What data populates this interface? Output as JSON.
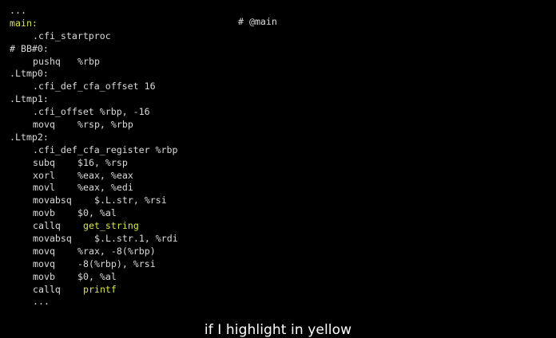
{
  "code": {
    "lines": [
      {
        "kind": "plain",
        "indent": false,
        "text": "..."
      },
      {
        "kind": "label",
        "indent": false,
        "text": "main:"
      },
      {
        "kind": "plain",
        "indent": true,
        "text": ".cfi_startproc"
      },
      {
        "kind": "plain",
        "indent": false,
        "text": "# BB#0:"
      },
      {
        "kind": "instr",
        "indent": true,
        "op": "pushq",
        "args": "%rbp",
        "opw": 8
      },
      {
        "kind": "plain",
        "indent": false,
        "text": ".Ltmp0:"
      },
      {
        "kind": "plain",
        "indent": true,
        "text": ".cfi_def_cfa_offset 16"
      },
      {
        "kind": "plain",
        "indent": false,
        "text": ".Ltmp1:"
      },
      {
        "kind": "plain",
        "indent": true,
        "text": ".cfi_offset %rbp, -16"
      },
      {
        "kind": "instr",
        "indent": true,
        "op": "movq",
        "args": "%rsp, %rbp",
        "opw": 8
      },
      {
        "kind": "plain",
        "indent": false,
        "text": ".Ltmp2:"
      },
      {
        "kind": "plain",
        "indent": true,
        "text": ".cfi_def_cfa_register %rbp"
      },
      {
        "kind": "instr",
        "indent": true,
        "op": "subq",
        "args": "$16, %rsp",
        "opw": 8
      },
      {
        "kind": "instr",
        "indent": true,
        "op": "xorl",
        "args": "%eax, %eax",
        "opw": 8
      },
      {
        "kind": "instr",
        "indent": true,
        "op": "movl",
        "args": "%eax, %edi",
        "opw": 8
      },
      {
        "kind": "instr",
        "indent": true,
        "op": "movabsq",
        "args": "$.L.str, %rsi",
        "opw": 11
      },
      {
        "kind": "instr",
        "indent": true,
        "op": "movb",
        "args": "$0, %al",
        "opw": 8
      },
      {
        "kind": "call",
        "indent": true,
        "op": "callq",
        "args": "get_string",
        "opw": 9
      },
      {
        "kind": "instr",
        "indent": true,
        "op": "movabsq",
        "args": "$.L.str.1, %rdi",
        "opw": 11
      },
      {
        "kind": "instr",
        "indent": true,
        "op": "movq",
        "args": "%rax, -8(%rbp)",
        "opw": 8
      },
      {
        "kind": "instr",
        "indent": true,
        "op": "movq",
        "args": "-8(%rbp), %rsi",
        "opw": 8
      },
      {
        "kind": "instr",
        "indent": true,
        "op": "movb",
        "args": "$0, %al",
        "opw": 8
      },
      {
        "kind": "call",
        "indent": true,
        "op": "callq",
        "args": "printf",
        "opw": 9
      },
      {
        "kind": "plain",
        "indent": true,
        "text": "..."
      }
    ],
    "main_comment": "# @main"
  },
  "caption": "if I highlight in yellow",
  "colors": {
    "background": "#000000",
    "text": "#d9d9d9",
    "highlight": "#d7e34a",
    "caption": "#ffffff"
  }
}
